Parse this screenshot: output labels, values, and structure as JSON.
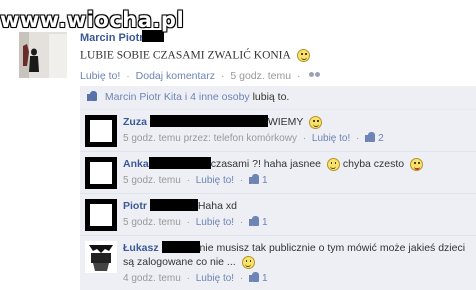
{
  "watermark": "www.wiocha.pl",
  "post": {
    "author": "Marcin Piotr",
    "text": "LUBIE SOBIE CZASAMI ZWALIĆ KONIA",
    "meta": {
      "like": "Lubię to!",
      "comment": "Dodaj komentarz",
      "time": "5 godz. temu"
    }
  },
  "likes_bar": {
    "people_link": "Marcin Piotr Kita i 4 inne osoby",
    "suffix": "lubią to."
  },
  "comments": [
    {
      "author": "Zuza",
      "text": "WIEMY",
      "time": "5 godz. temu przez: telefon komórkowy",
      "like": "Lubię to!",
      "count": "2"
    },
    {
      "author": "Anka",
      "text_a": "czasami ?! haha jasnee",
      "text_b": "chyba czesto",
      "time": "5 godz. temu",
      "like": "Lubię to!",
      "count": "1"
    },
    {
      "author": "Piotr",
      "text": "Haha xd",
      "time": "5 godz. temu",
      "like": "Lubię to!",
      "count": "1"
    },
    {
      "author": "Łukasz",
      "text": "nie musisz tak publicznie o tym mówić może jakieś dzieci są zalogowane co nie ...",
      "time": "4 godz. temu",
      "like": "Lubię to!",
      "count": "1"
    }
  ],
  "separator": "·",
  "icons": {
    "smiley": "smiley-icon",
    "tongue": "tongue-smiley-icon",
    "thumb": "thumbs-up-icon",
    "audience": "friends-icon"
  },
  "colors": {
    "link": "#3b5998",
    "meta_link": "#6d84b4",
    "comment_bg": "#edeff4"
  }
}
